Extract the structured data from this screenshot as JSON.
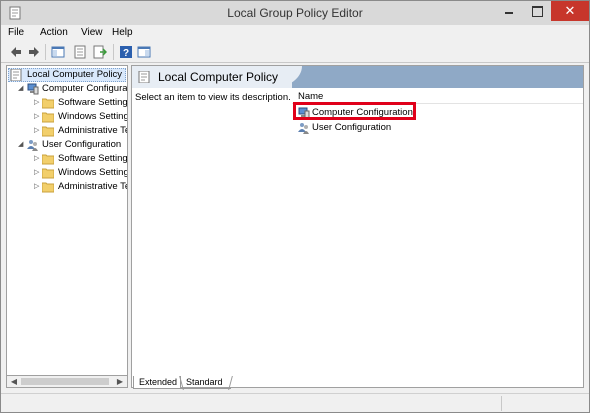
{
  "window": {
    "title": "Local Group Policy Editor"
  },
  "menu": [
    "File",
    "Action",
    "View",
    "Help"
  ],
  "toolbar": {
    "buttons": [
      "back-icon",
      "forward-icon",
      "show-hide-tree-icon",
      "properties-icon",
      "export-list-icon",
      "help-icon",
      "show-hide-action-pane-icon"
    ]
  },
  "tree": {
    "root": "Local Computer Policy",
    "computer_config": "Computer Configura",
    "computer_children": [
      "Software Settings",
      "Windows Setting",
      "Administrative Te"
    ],
    "user_config": "User Configuration",
    "user_children": [
      "Software Settings",
      "Windows Setting",
      "Administrative Te"
    ]
  },
  "details": {
    "title": "Local Computer Policy",
    "description": "Select an item to view its description.",
    "column_name": "Name",
    "items": [
      "Computer Configuration",
      "User Configuration"
    ]
  },
  "tabs": [
    "Extended",
    "Standard"
  ],
  "colors": {
    "highlight": "#e0001a",
    "header": "#8fa9c6",
    "close": "#c7362b"
  }
}
